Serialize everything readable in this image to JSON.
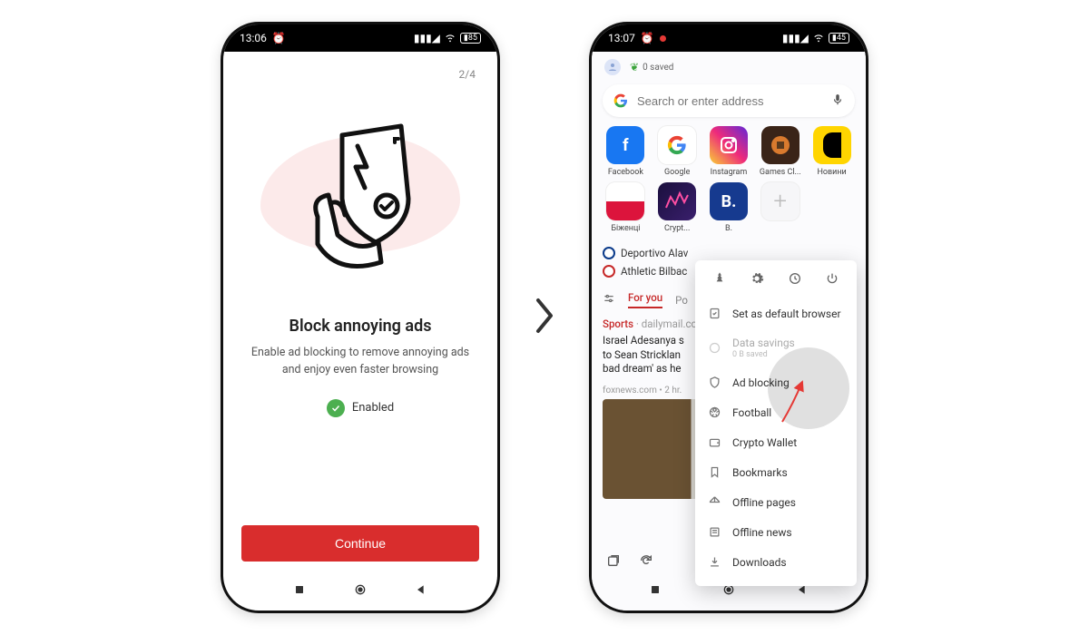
{
  "phone1": {
    "status": {
      "time": "13:06",
      "battery": "85"
    },
    "page_indicator": "2/4",
    "title": "Block annoying ads",
    "subtitle": "Enable ad blocking to remove annoying ads and enjoy even faster browsing",
    "enabled_label": "Enabled",
    "continue_label": "Continue"
  },
  "phone2": {
    "status": {
      "time": "13:07",
      "battery": "45"
    },
    "saved_label": "0 saved",
    "search": {
      "placeholder": "Search or enter address"
    },
    "apps": [
      {
        "label": "Facebook",
        "letter": "f",
        "cls": "fb"
      },
      {
        "label": "Google",
        "letter": "G",
        "cls": "gg"
      },
      {
        "label": "Instagram",
        "letter": "",
        "cls": "ig"
      },
      {
        "label": "Games Cl...",
        "letter": "",
        "cls": "gc"
      },
      {
        "label": "Новини",
        "letter": "",
        "cls": "nv"
      },
      {
        "label": "Біженці",
        "letter": "",
        "cls": "pl"
      },
      {
        "label": "Crypt...",
        "letter": "",
        "cls": "cr"
      },
      {
        "label": "B.",
        "letter": "B.",
        "cls": "bk"
      },
      {
        "label": "",
        "letter": "+",
        "cls": "plus"
      }
    ],
    "sports": [
      {
        "team": "Deportivo Alav"
      },
      {
        "team": "Athletic Bilbac"
      }
    ],
    "feed": {
      "tab_active": "For you",
      "tab_other": "Po"
    },
    "article": {
      "category": "Sports",
      "site": "dailymail.co",
      "headline": "Israel Adesanya s\nto Sean Stricklan\nbad dream' as he",
      "meta": "foxnews.com • 2 hr."
    },
    "menu": {
      "default": "Set as default browser",
      "data_savings": "Data savings",
      "data_savings_sub": "0 B saved",
      "ad_blocking": "Ad blocking",
      "football": "Football",
      "crypto": "Crypto Wallet",
      "bookmarks": "Bookmarks",
      "offline_pages": "Offline pages",
      "offline_news": "Offline news",
      "downloads": "Downloads"
    }
  }
}
